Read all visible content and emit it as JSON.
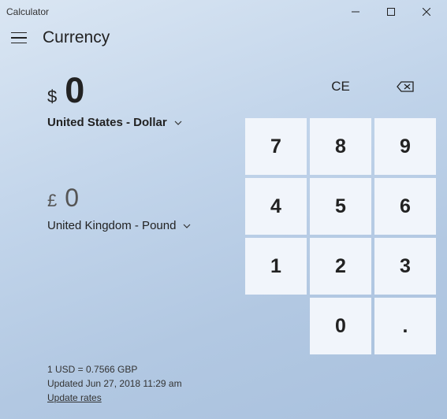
{
  "window": {
    "title": "Calculator"
  },
  "header": {
    "mode": "Currency"
  },
  "from": {
    "symbol": "$",
    "value": "0",
    "currency_label": "United States - Dollar"
  },
  "to": {
    "symbol": "£",
    "value": "0",
    "currency_label": "United Kingdom - Pound"
  },
  "rate": {
    "text": "1 USD = 0.7566 GBP",
    "updated": "Updated Jun 27, 2018 11:29 am",
    "link": "Update rates"
  },
  "keypad": {
    "ce": "CE",
    "k7": "7",
    "k8": "8",
    "k9": "9",
    "k4": "4",
    "k5": "5",
    "k6": "6",
    "k1": "1",
    "k2": "2",
    "k3": "3",
    "k0": "0",
    "dot": "."
  }
}
